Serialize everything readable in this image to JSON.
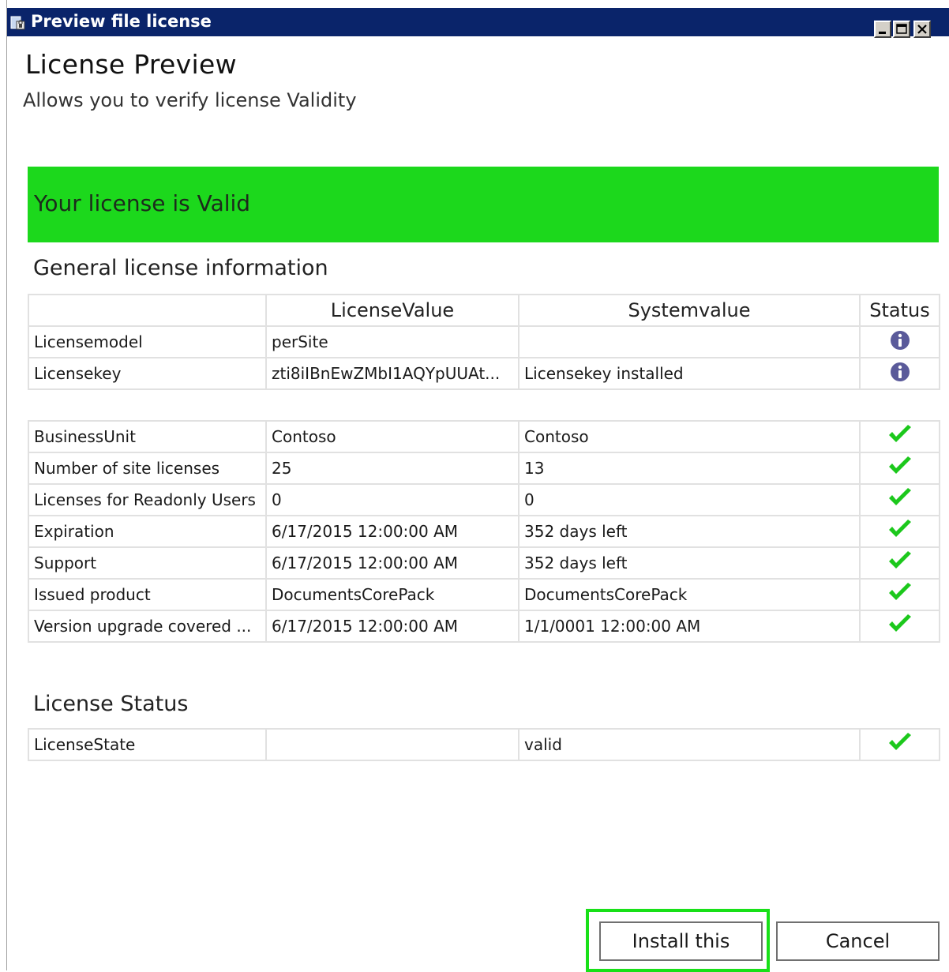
{
  "window": {
    "title": "Preview file license"
  },
  "header": {
    "title": "License Preview",
    "subtitle": "Allows you to verify license Validity"
  },
  "banner": {
    "text": "Your license is Valid",
    "color": "#1cd81c"
  },
  "general_section": {
    "title": "General license information",
    "columns": [
      "",
      "LicenseValue",
      "Systemvalue",
      "Status"
    ],
    "info_rows": [
      {
        "name": "Licensemodel",
        "license_value": "perSite",
        "system_value": "",
        "status": "info-icon"
      },
      {
        "name": "Licensekey",
        "license_value": "zti8iIBnEwZMbI1AQYpUUAt...",
        "system_value": "Licensekey installed",
        "status": "info-icon"
      }
    ],
    "check_rows": [
      {
        "name": "BusinessUnit",
        "license_value": "Contoso",
        "system_value": "Contoso",
        "status": "checkmark-icon"
      },
      {
        "name": "Number of site licenses",
        "license_value": "25",
        "system_value": "13",
        "status": "checkmark-icon"
      },
      {
        "name": "Licenses for Readonly Users",
        "license_value": "0",
        "system_value": "0",
        "status": "checkmark-icon"
      },
      {
        "name": "Expiration",
        "license_value": "6/17/2015 12:00:00 AM",
        "system_value": "352 days left",
        "status": "checkmark-icon"
      },
      {
        "name": "Support",
        "license_value": "6/17/2015 12:00:00 AM",
        "system_value": "352 days left",
        "status": "checkmark-icon"
      },
      {
        "name": "Issued product",
        "license_value": "DocumentsCorePack",
        "system_value": "DocumentsCorePack",
        "status": "checkmark-icon"
      },
      {
        "name": "Version upgrade covered ...",
        "license_value": "6/17/2015 12:00:00 AM",
        "system_value": "1/1/0001 12:00:00 AM",
        "status": "checkmark-icon"
      }
    ]
  },
  "status_section": {
    "title": "License Status",
    "rows": [
      {
        "name": "LicenseState",
        "license_value": "",
        "system_value": "valid",
        "status": "checkmark-icon"
      }
    ]
  },
  "buttons": {
    "install": "Install this",
    "cancel": "Cancel"
  },
  "colors": {
    "titlebar": "#0a246a",
    "check": "#1cc81c",
    "info": "#5a5a9a",
    "highlight": "#18e018"
  }
}
